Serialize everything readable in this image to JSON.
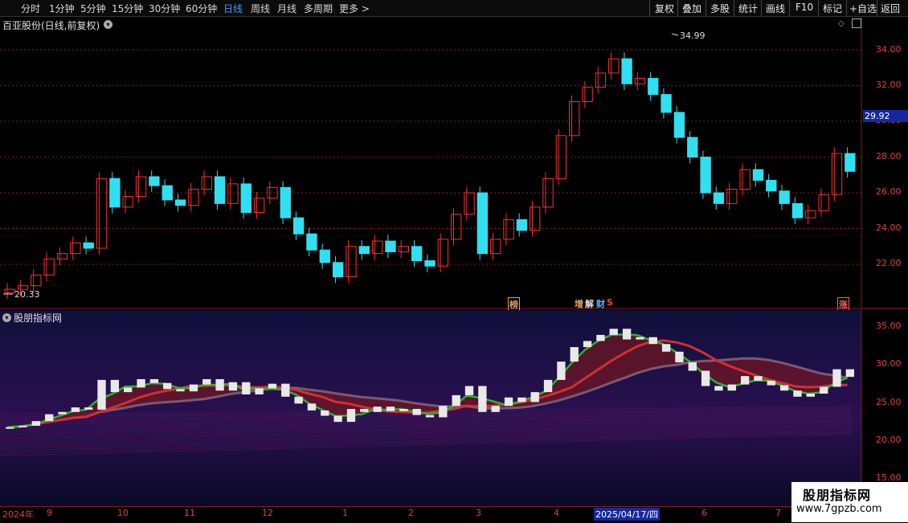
{
  "toolbar": {
    "periods": [
      "分时",
      "1分钟",
      "5分钟",
      "15分钟",
      "30分钟",
      "60分钟",
      "日线",
      "周线",
      "月线",
      "多周期",
      "更多"
    ],
    "active_period": "日线",
    "more_arrow": ">",
    "actions": [
      "复权",
      "叠加",
      "多股",
      "统计",
      "画线",
      "F10",
      "标记",
      "+自选",
      "返回"
    ]
  },
  "price_panel": {
    "title": "百亚股份(日线,前复权)",
    "y_ticks": [
      "34.00",
      "32.00",
      "30.00",
      "28.00",
      "26.00",
      "24.00",
      "22.00"
    ],
    "current_price": "29.92",
    "high_label": "34.99",
    "low_label": "20.33",
    "badges": [
      {
        "text": "榜",
        "color": "#e0a060"
      },
      {
        "text": "增",
        "color": "#e0a060"
      },
      {
        "text": "解",
        "color": "#e0e0e0"
      },
      {
        "text": "财",
        "color": "#60b0ff"
      },
      {
        "text": "S",
        "color": "#ff4040"
      },
      {
        "text": "涨",
        "color": "#ff6060"
      }
    ]
  },
  "indicator_panel": {
    "title": "股朋指标网",
    "y_ticks": [
      "35.00",
      "30.00",
      "25.00",
      "20.00",
      "15.00"
    ]
  },
  "date_axis": {
    "labels": [
      "2024年",
      "9",
      "10",
      "11",
      "12",
      "1",
      "2",
      "3",
      "4",
      "2025/04/17/四",
      "6",
      "7"
    ]
  },
  "watermark": {
    "title": "股朋指标网",
    "url": "www.7gpzb.com"
  },
  "colors": {
    "up": "#ff3030",
    "down": "#30e0f0",
    "grid": "#8a1c1c",
    "accent": "#39a0ff"
  },
  "chart_data": {
    "type": "candlestick",
    "title": "百亚股份(日线,前复权)",
    "ylim": [
      20,
      35
    ],
    "series": [
      {
        "name": "close",
        "values": [
          20.6,
          20.8,
          21.4,
          22.3,
          22.6,
          23.2,
          22.9,
          26.8,
          25.2,
          25.8,
          26.9,
          26.4,
          25.6,
          25.3,
          26.2,
          26.9,
          25.4,
          26.5,
          24.9,
          25.7,
          26.3,
          24.6,
          23.7,
          22.8,
          22.1,
          21.3,
          23.0,
          22.6,
          23.3,
          22.7,
          23.0,
          22.2,
          21.9,
          23.4,
          24.8,
          26.0,
          22.6,
          23.4,
          24.5,
          23.9,
          25.2,
          26.8,
          29.2,
          31.1,
          31.9,
          32.7,
          33.5,
          32.1,
          32.4,
          31.5,
          30.5,
          29.1,
          28.0,
          26.0,
          25.4,
          26.2,
          27.3,
          26.7,
          26.1,
          25.4,
          24.6,
          25.0,
          25.9,
          28.2,
          27.2
        ]
      }
    ],
    "annotations": {
      "high": 34.99,
      "low": 20.33,
      "last": 29.92
    },
    "xlabel": "",
    "ylabel": ""
  }
}
